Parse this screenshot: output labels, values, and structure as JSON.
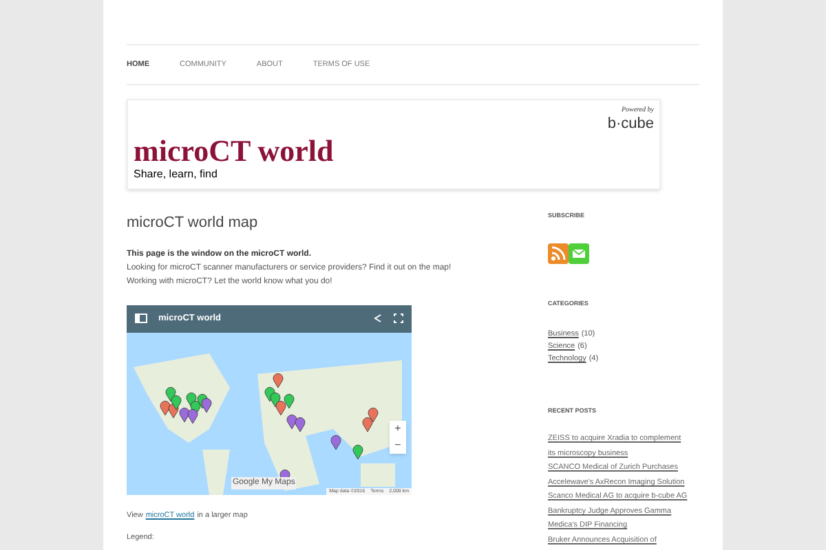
{
  "nav": [
    {
      "label": "HOME",
      "selected": true
    },
    {
      "label": "COMMUNITY",
      "selected": false
    },
    {
      "label": "ABOUT",
      "selected": false
    },
    {
      "label": "TERMS OF USE",
      "selected": false
    }
  ],
  "banner": {
    "title": "microCT world",
    "tagline": "Share, learn, find",
    "sponsor_caption": "Powered by",
    "sponsor": "b·cube"
  },
  "page": {
    "title": "microCT world map",
    "lead": "This page is the window on the microCT world.",
    "lines": [
      "Looking for microCT scanner manufacturers or service providers? Find it out on the map!",
      "Working with microCT? Let the world know what you do!"
    ],
    "map": {
      "title": "microCT world",
      "brand": "Google My Maps",
      "attribution": "Map data ©2016",
      "terms": "Terms",
      "scale": "2,000 km",
      "zoom_in": "+",
      "zoom_out": "−"
    },
    "view_link": {
      "before": "View",
      "link": "microCT world",
      "after": "in a larger map"
    },
    "legend": "Legend:"
  },
  "sidebar": {
    "subscribe": {
      "title": "SUBSCRIBE"
    },
    "categories": {
      "title": "CATEGORIES",
      "items": [
        {
          "name": "Business",
          "count": "(10)"
        },
        {
          "name": "Science",
          "count": "(6)"
        },
        {
          "name": "Technology",
          "count": "(4)"
        }
      ]
    },
    "recent_posts": {
      "title": "RECENT POSTS",
      "items": [
        "ZEISS to acquire Xradia to complement its microscopy business",
        "SCANCO Medical of Zurich Purchases Accelewave's AxRecon Imaging Solution",
        "Scanco Medical AG to acquire b-cube AG",
        "Bankruptcy Judge Approves Gamma Medica's DIP Financing",
        "Bruker Announces Acquisition of"
      ]
    }
  }
}
